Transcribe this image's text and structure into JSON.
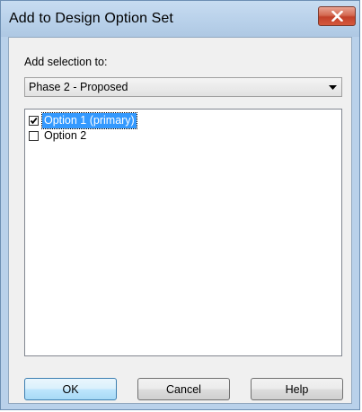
{
  "window": {
    "title": "Add to Design Option Set"
  },
  "form": {
    "add_selection_label": "Add selection to:",
    "set_value": "Phase 2 - Proposed"
  },
  "options": [
    {
      "label": "Option 1 (primary)",
      "checked": true,
      "selected": true
    },
    {
      "label": "Option 2",
      "checked": false,
      "selected": false
    }
  ],
  "buttons": {
    "ok": "OK",
    "cancel": "Cancel",
    "help": "Help"
  },
  "icons": {
    "close": "close-x-icon",
    "dropdown": "chevron-down-icon",
    "check": "checkmark-icon"
  },
  "colors": {
    "title_bar": "#b9d1ea",
    "close_button": "#c94a31",
    "selection_highlight": "#3399ff",
    "dialog_body": "#f0f0f0"
  }
}
